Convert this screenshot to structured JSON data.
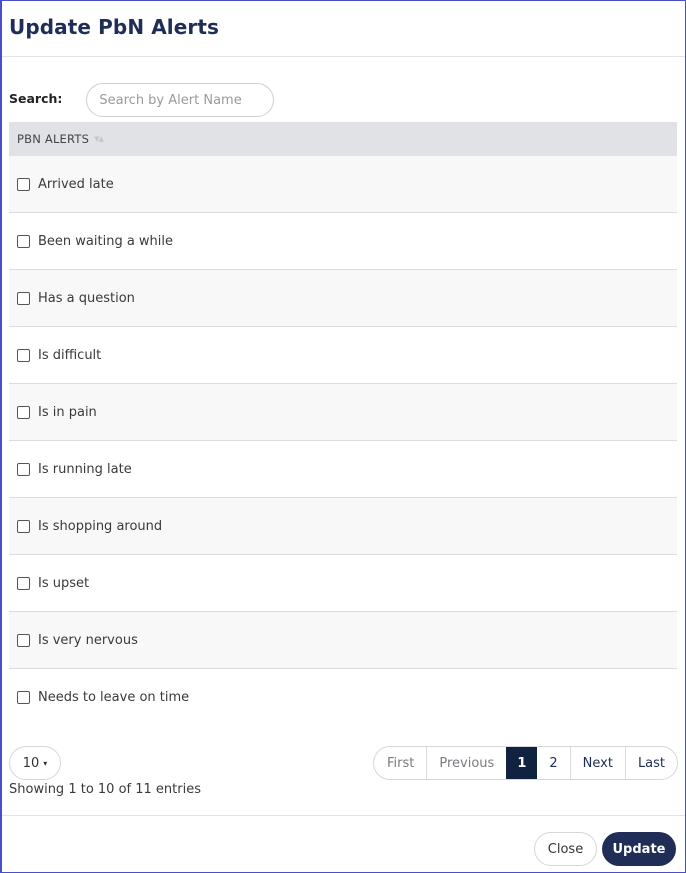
{
  "dialog": {
    "title": "Update PbN Alerts"
  },
  "search": {
    "label": "Search:",
    "value": "",
    "placeholder": "Search by Alert Name"
  },
  "table": {
    "column_header": "PBN ALERTS",
    "sort_icon": "sort-both-icon",
    "rows": [
      {
        "label": "Arrived late",
        "checked": false
      },
      {
        "label": "Been waiting a while",
        "checked": false
      },
      {
        "label": "Has a question",
        "checked": false
      },
      {
        "label": "Is difficult",
        "checked": false
      },
      {
        "label": "Is in pain",
        "checked": false
      },
      {
        "label": "Is running late",
        "checked": false
      },
      {
        "label": "Is shopping around",
        "checked": false
      },
      {
        "label": "Is upset",
        "checked": false
      },
      {
        "label": "Is very nervous",
        "checked": false
      },
      {
        "label": "Needs to leave on time",
        "checked": false
      }
    ]
  },
  "length_select": {
    "value": "10",
    "caret": "▾"
  },
  "info": {
    "text": "Showing 1 to 10 of 11 entries"
  },
  "pagination": {
    "first": "First",
    "previous": "Previous",
    "pages": [
      "1",
      "2"
    ],
    "current_page": "1",
    "next": "Next",
    "last": "Last"
  },
  "footer": {
    "close_label": "Close",
    "update_label": "Update"
  },
  "colors": {
    "primary": "#1f2d57",
    "active_page": "#0f2341",
    "window_border": "#4a4fc9",
    "header_bg": "#e1e2e6"
  }
}
